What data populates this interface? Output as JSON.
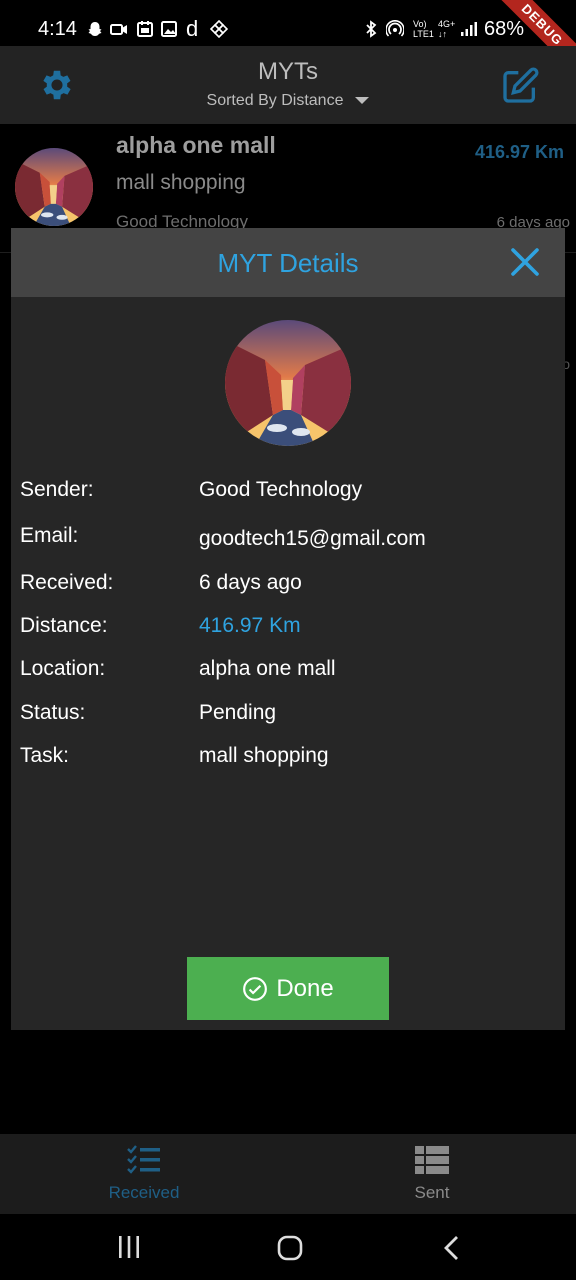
{
  "status_bar": {
    "time": "4:14",
    "battery": "68%",
    "debug_banner": "DEBUG",
    "lte_top": "Vo)",
    "lte_bottom": "LTE1",
    "net": "4G+"
  },
  "app_bar": {
    "title": "MYTs",
    "sort_label": "Sorted By Distance"
  },
  "list": {
    "items": [
      {
        "title": "alpha one mall",
        "task": "mall shopping",
        "sender": "Good Technology",
        "distance": "416.97 Km",
        "time": "6 days ago"
      }
    ],
    "peek_text": "o"
  },
  "dialog": {
    "title": "MYT Details",
    "fields": [
      {
        "label": "Sender:",
        "value": "Good Technology"
      },
      {
        "label": "Email:",
        "value": "goodtech15@gmail.com"
      },
      {
        "label": "Received:",
        "value": "6 days ago"
      },
      {
        "label": "Distance:",
        "value": "416.97 Km"
      },
      {
        "label": "Location:",
        "value": "alpha one mall"
      },
      {
        "label": "Status:",
        "value": "Pending"
      },
      {
        "label": "Task:",
        "value": "mall shopping"
      }
    ],
    "done_label": "Done"
  },
  "bottom_nav": {
    "items": [
      {
        "label": "Received",
        "icon": "checklist-icon",
        "active": true
      },
      {
        "label": "Sent",
        "icon": "list-icon",
        "active": false
      }
    ]
  },
  "colors": {
    "accent": "#2fa3e0",
    "nav_active": "#1f5f86",
    "done": "#4caf50"
  }
}
